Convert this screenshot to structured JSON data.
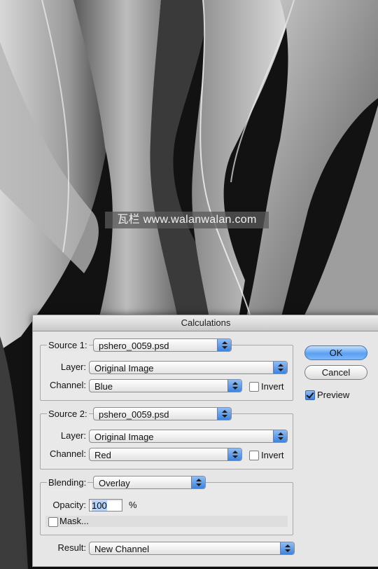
{
  "watermark": "瓦栏 www.walanwalan.com",
  "dialog": {
    "title": "Calculations",
    "source1": {
      "label": "Source 1:",
      "file": "pshero_0059.psd",
      "layer_label": "Layer:",
      "layer": "Original Image",
      "channel_label": "Channel:",
      "channel": "Blue",
      "invert_label": "Invert",
      "invert": false
    },
    "source2": {
      "label": "Source 2:",
      "file": "pshero_0059.psd",
      "layer_label": "Layer:",
      "layer": "Original Image",
      "channel_label": "Channel:",
      "channel": "Red",
      "invert_label": "Invert",
      "invert": false
    },
    "blending": {
      "label": "Blending:",
      "mode": "Overlay",
      "opacity_label": "Opacity:",
      "opacity": "100",
      "opacity_unit": "%",
      "mask_label": "Mask...",
      "mask": false
    },
    "result_label": "Result:",
    "result": "New Channel",
    "buttons": {
      "ok": "OK",
      "cancel": "Cancel"
    },
    "preview_label": "Preview",
    "preview": true
  }
}
